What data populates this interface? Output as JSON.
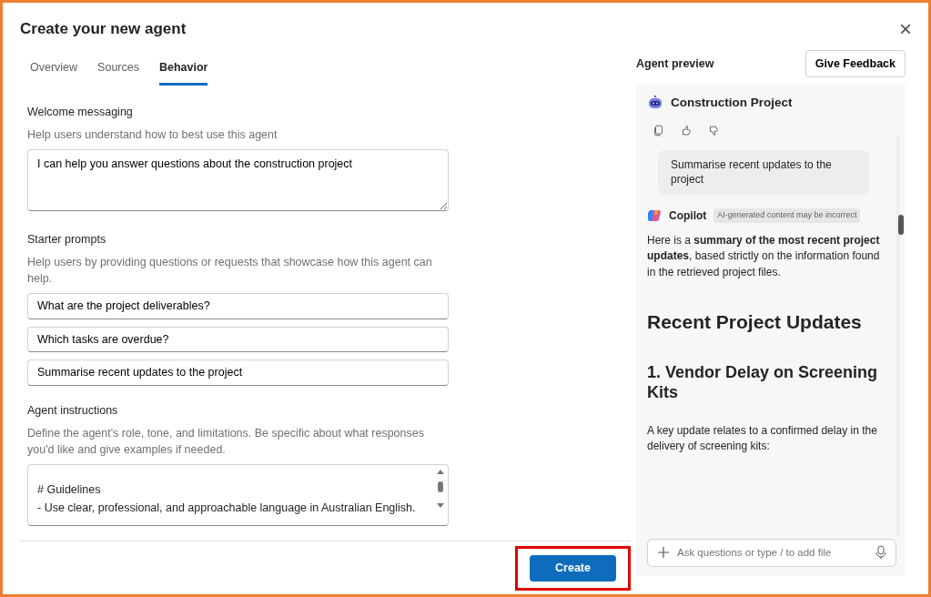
{
  "dialog": {
    "title": "Create your new agent",
    "close": "×"
  },
  "tabs": [
    {
      "label": "Overview",
      "selected": false
    },
    {
      "label": "Sources",
      "selected": false
    },
    {
      "label": "Behavior",
      "selected": true
    }
  ],
  "sections": [
    {
      "kind": "textarea",
      "label": "Welcome messaging",
      "help": "Help users understand how to best use this agent",
      "value": "I can help you answer questions about the construction project"
    },
    {
      "kind": "prompts",
      "label": "Starter prompts",
      "help": "Help users by providing questions or requests that showcase how this agent can help.",
      "prompts": [
        "What are the project deliverables?",
        "Which tasks are overdue?",
        "Summarise recent updates to the project"
      ]
    },
    {
      "kind": "instructions",
      "label": "Agent instructions",
      "help": "Define the agent's role, tone, and limitations. Be specific about what responses you'd like and give examples if needed.",
      "lines": [
        "# Guidelines",
        "- Use clear, professional, and approachable language in Australian English."
      ]
    }
  ],
  "footer": {
    "create_button": "Create",
    "highlighted": true
  },
  "preview": {
    "title": "Agent preview",
    "feedback_button": "Give Feedback",
    "agent_name": "Construction Project",
    "user_message": "Summarise recent updates to the project",
    "assistant": {
      "name": "Copilot",
      "badge": "AI-generated content may be incorrect",
      "intro": "Here is a **summary of the most recent project updates**, based strictly on the information found in the retrieved project files.",
      "heading": "Recent Project Updates",
      "subheading": "1. Vendor Delay on Screening Kits",
      "paragraph": "A key update relates to a confirmed delay in the delivery of screening kits:"
    },
    "input_placeholder": "Ask questions or type / to add file"
  }
}
